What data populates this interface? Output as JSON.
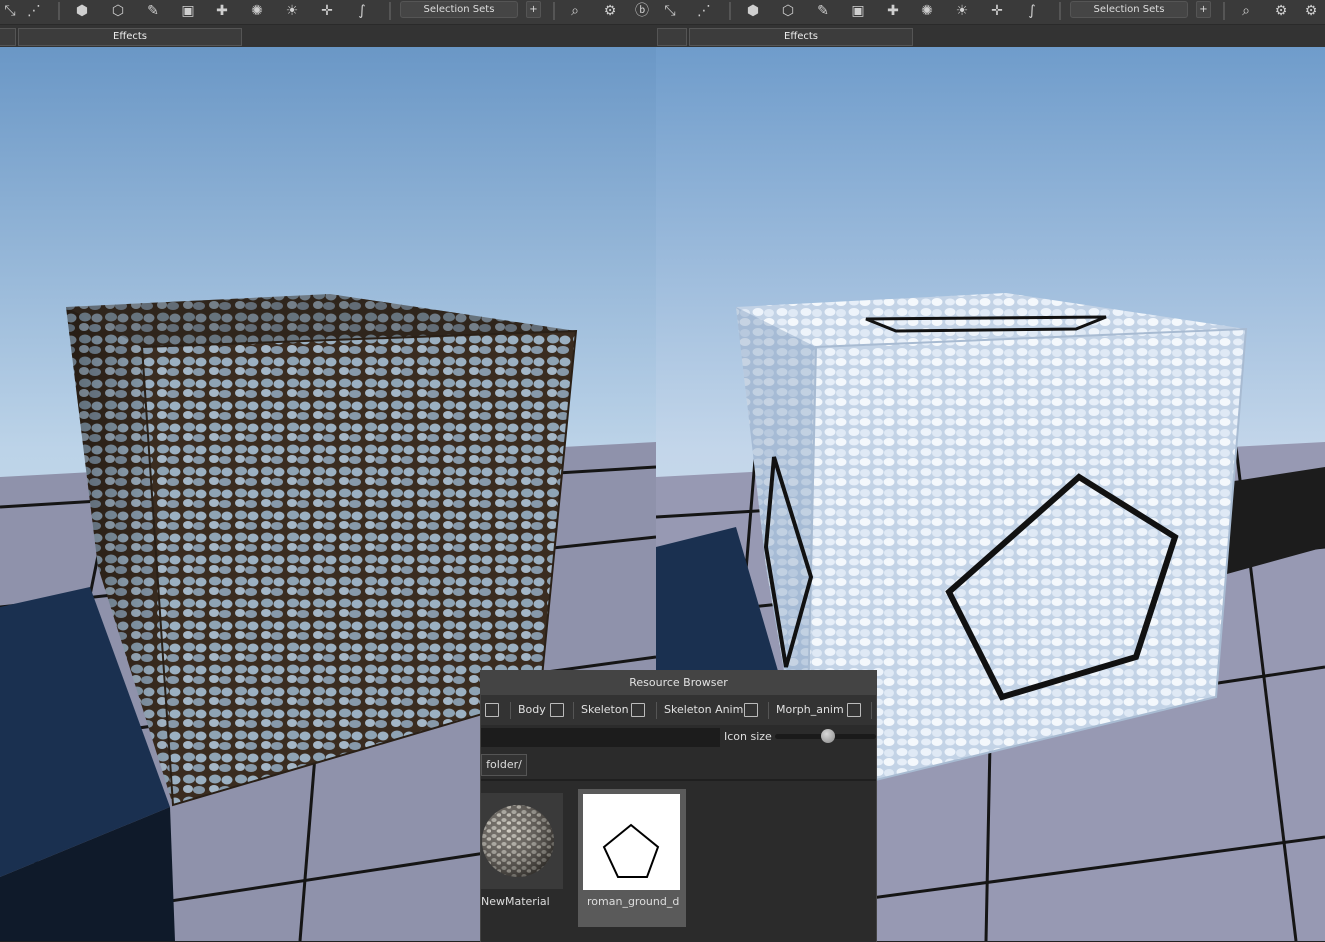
{
  "toolbar": {
    "selection_sets": "Selection Sets",
    "add_button": "+",
    "effects": "Effects",
    "icons": [
      "pose-icon",
      "select-vertex-icon",
      "create-mesh-icon",
      "add-mesh-icon",
      "pen-tool-icon",
      "add-object-icon",
      "add-material-icon",
      "particles-icon",
      "add-light-icon",
      "add-point-icon",
      "add-spline-icon"
    ]
  },
  "viewports": {
    "left": {
      "name": "Cobblestone material preview"
    },
    "right": {
      "name": "Snow material preview with decal"
    }
  },
  "resource_browser": {
    "title": "Resource Browser",
    "filters": [
      "Body",
      "Skeleton",
      "Skeleton Anim",
      "Morph_anim"
    ],
    "search": {
      "value": "",
      "placeholder": ""
    },
    "icon_size_label": "Icon size",
    "icon_size_value": 0.55,
    "path": "folder/",
    "items": [
      {
        "name": "NewMaterial",
        "selected": false
      },
      {
        "name": "roman_ground_d",
        "selected": true
      }
    ]
  },
  "colors": {
    "panel_bg": "#2b2b2b",
    "title_bg": "#444444",
    "selected_tile": "#5a5a5a",
    "toolbar_bg": "#3a3a3a"
  }
}
